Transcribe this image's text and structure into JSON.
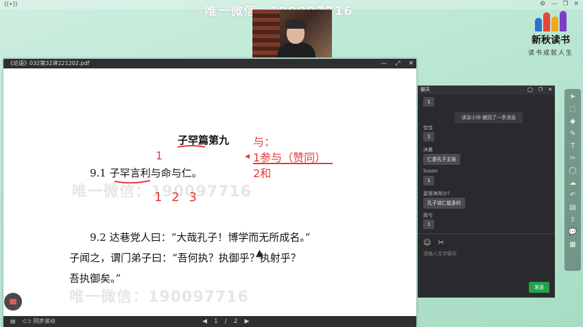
{
  "watermarks": {
    "top": "唯一微信：190097716",
    "mid": "唯一微信：190097716",
    "lower": "唯一微信：190097716"
  },
  "brand": {
    "name": "新秋读书",
    "slogan": "读书成就人生"
  },
  "pdf": {
    "title": "《论语》032第32讲221202.pdf",
    "doc_title": "子罕篇第九",
    "line1": "9.1 子罕言利与命与仁。",
    "line2": "9.2 达巷党人曰：“大哉孔子！博学而无所成名。”",
    "line3": "子闻之，谓门弟子曰：“吾何执？执御乎？执射乎？",
    "line4": "吾执御矣。”",
    "annot_yu": "与：",
    "annot_1": "1参与（赞同）",
    "annot_2": "2和",
    "annot_num_1": "1",
    "annot_nums": "1   2   3",
    "page_current": "1",
    "page_sep": "/",
    "page_total": "2",
    "sync_label": "同步滚动"
  },
  "chat": {
    "title": "聊天",
    "messages": [
      {
        "name": "",
        "text": "1"
      },
      {
        "system": "读柒小帅 撤回了一条消息"
      },
      {
        "name": "佳佳",
        "text": "1"
      },
      {
        "name": "沐晨",
        "text": "仁是孔子主张"
      },
      {
        "name": "Susan",
        "text": "1"
      },
      {
        "name": "星宿海淘沙?",
        "text": "孔子讲仁挺多的"
      },
      {
        "name": "简兮",
        "text": "1"
      }
    ],
    "placeholder": "请输入文字聊天",
    "send_label": "发送"
  },
  "colors": {
    "accent": "#22a34a",
    "annotation": "#e23a3a"
  }
}
